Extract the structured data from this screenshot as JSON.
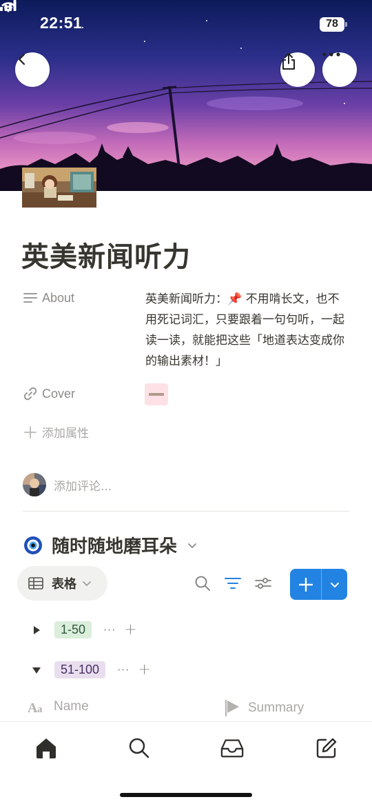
{
  "status_bar": {
    "time": "22:51",
    "battery": "78"
  },
  "page": {
    "title": "英美新闻听力"
  },
  "properties": {
    "about_label": "About",
    "about_value": "英美新闻听力：📌 不用啃长文，也不用死记词汇，只要跟着一句句听，一起读一读，就能把这些「地道表达变成你的输出素材！」",
    "cover_label": "Cover",
    "add_property_label": "添加属性"
  },
  "comment": {
    "placeholder": "添加评论..."
  },
  "database": {
    "emoji": "nazar-amulet-icon",
    "title": "随时随地磨耳朵",
    "view_label": "表格",
    "groups": [
      {
        "label": "1-50",
        "expanded": false,
        "color": "#dbeddb",
        "text_color": "#2b593f"
      },
      {
        "label": "51-100",
        "expanded": true,
        "color": "#e8deee",
        "text_color": "#492f64"
      }
    ],
    "group_more": "···",
    "group_add": "+",
    "columns": [
      {
        "label": "Name",
        "icon": "title-aa-icon"
      },
      {
        "label": "Summary",
        "icon": "flag-icon"
      }
    ]
  },
  "tabbar": {
    "items": [
      "home-icon",
      "search-icon",
      "inbox-icon",
      "compose-icon"
    ]
  },
  "colors": {
    "accent": "#2383e2",
    "text": "#37352f",
    "muted": "#8c8b87"
  }
}
